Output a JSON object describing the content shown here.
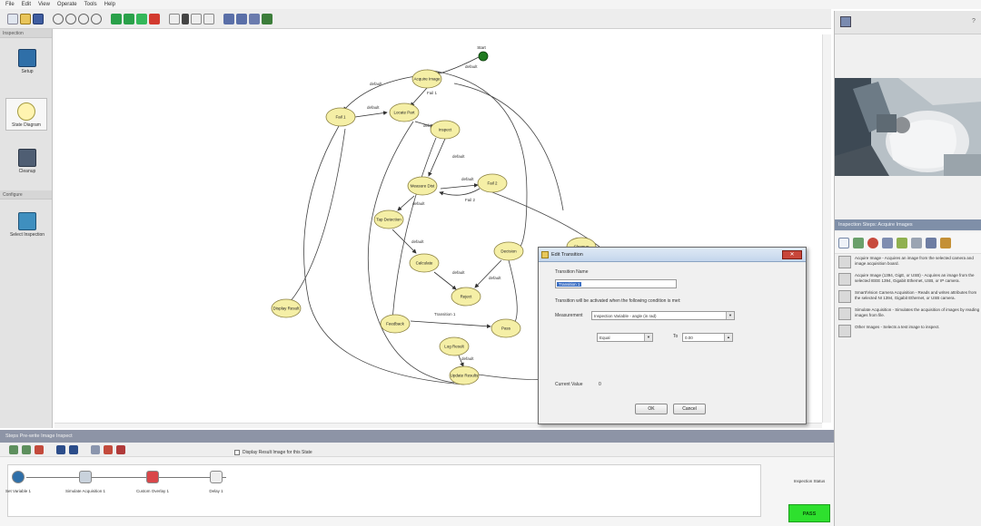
{
  "menubar": {
    "items": [
      "File",
      "Edit",
      "View",
      "Operate",
      "Tools",
      "Help"
    ]
  },
  "toolbar": {
    "buttons": [
      "new",
      "open",
      "save",
      "zoom-in",
      "zoom-out",
      "zoom-fit",
      "zoom-actual",
      "run",
      "run-continuous",
      "stop",
      "step",
      "pause",
      "help",
      "prev",
      "next",
      "camera"
    ]
  },
  "left_panel": {
    "inspection_header": "Inspection",
    "items": [
      {
        "label": "Setup",
        "icon": "camera-icon"
      },
      {
        "label": "State Diagram",
        "icon": "bulb-icon"
      },
      {
        "label": "Cleanup",
        "icon": "cleanup-icon"
      }
    ],
    "section_header": "Configure",
    "select_label": "Select Inspection"
  },
  "states": [
    {
      "id": "start",
      "label": "Start"
    },
    {
      "id": "acq",
      "label": "Acquire Image"
    },
    {
      "id": "fail1",
      "label": "Fail 1"
    },
    {
      "id": "loc",
      "label": "Locate Part"
    },
    {
      "id": "ins",
      "label": "Inspect"
    },
    {
      "id": "meas",
      "label": "Measure Dist"
    },
    {
      "id": "fail2",
      "label": "Fail 2"
    },
    {
      "id": "tap",
      "label": "Tap Detection"
    },
    {
      "id": "cal",
      "label": "Calculate"
    },
    {
      "id": "dec",
      "label": "Decision"
    },
    {
      "id": "bad",
      "label": "Reject"
    },
    {
      "id": "feed",
      "label": "Feedback"
    },
    {
      "id": "pass",
      "label": "Pass"
    },
    {
      "id": "disp",
      "label": "Display Result"
    },
    {
      "id": "logr",
      "label": "Log Result"
    },
    {
      "id": "cleanup",
      "label": "Cleanup"
    },
    {
      "id": "end",
      "label": "Update Results"
    }
  ],
  "transitions": [
    {
      "label": "default"
    },
    {
      "label": "default"
    },
    {
      "label": "Fail 1"
    },
    {
      "label": "default"
    },
    {
      "label": "default"
    },
    {
      "label": "default"
    },
    {
      "label": "default"
    },
    {
      "label": "Fail 2"
    },
    {
      "label": "default"
    },
    {
      "label": "default"
    },
    {
      "label": "default"
    },
    {
      "label": "default"
    },
    {
      "label": "Transition 1"
    },
    {
      "label": "default"
    }
  ],
  "right_panel": {
    "steps_header": "Inspection Steps: Acquire Images",
    "steps": [
      "Acquire Image - Acquires an image from the selected camera and image acquisition board.",
      "Acquire Image (1394, GigE, or USB) - Acquires an image from the selected IEEE 1394, Gigabit Ethernet, USB, or IP camera.",
      "Smart/Vision Camera Acquisition - Reads and writes attributes from the selected NI 1394, Gigabit Ethernet, or USB camera.",
      "Simulate Acquisition - Simulates the acquisition of images by reading images from file.",
      "Other Images - Selects a test image to inspect."
    ]
  },
  "bottom_panel": {
    "title": "Steps  Pre-write Image Inspect",
    "display_check_label": "Display Result Image for this State",
    "pipeline": [
      {
        "label": "Set Variable 1"
      },
      {
        "label": "Simulate Acquisition 1"
      },
      {
        "label": "Custom Overlay 1"
      },
      {
        "label": "Delay 1"
      }
    ],
    "status_label": "Inspection Status",
    "status_value": "PASS"
  },
  "dialog": {
    "title": "Edit Transition",
    "name_label": "Transition Name",
    "name_value": "Transition 1",
    "condition_text": "Transition will be activated when the following condition is met:",
    "measurement_label": "Measurement",
    "measurement_value": "Inspection Variable - angle (in rad)",
    "operator_value": "Equal",
    "value_label": "To",
    "value_value": "0.00",
    "current_value_label": "Current Value",
    "current_value": "0",
    "ok_label": "OK",
    "cancel_label": "Cancel"
  },
  "colors": {
    "state_fill": "#f5efa6",
    "state_stroke": "#8a8040",
    "start_fill": "#1f7a1f",
    "pass_green": "#2ee02e",
    "panel_title": "#8d94a6"
  }
}
